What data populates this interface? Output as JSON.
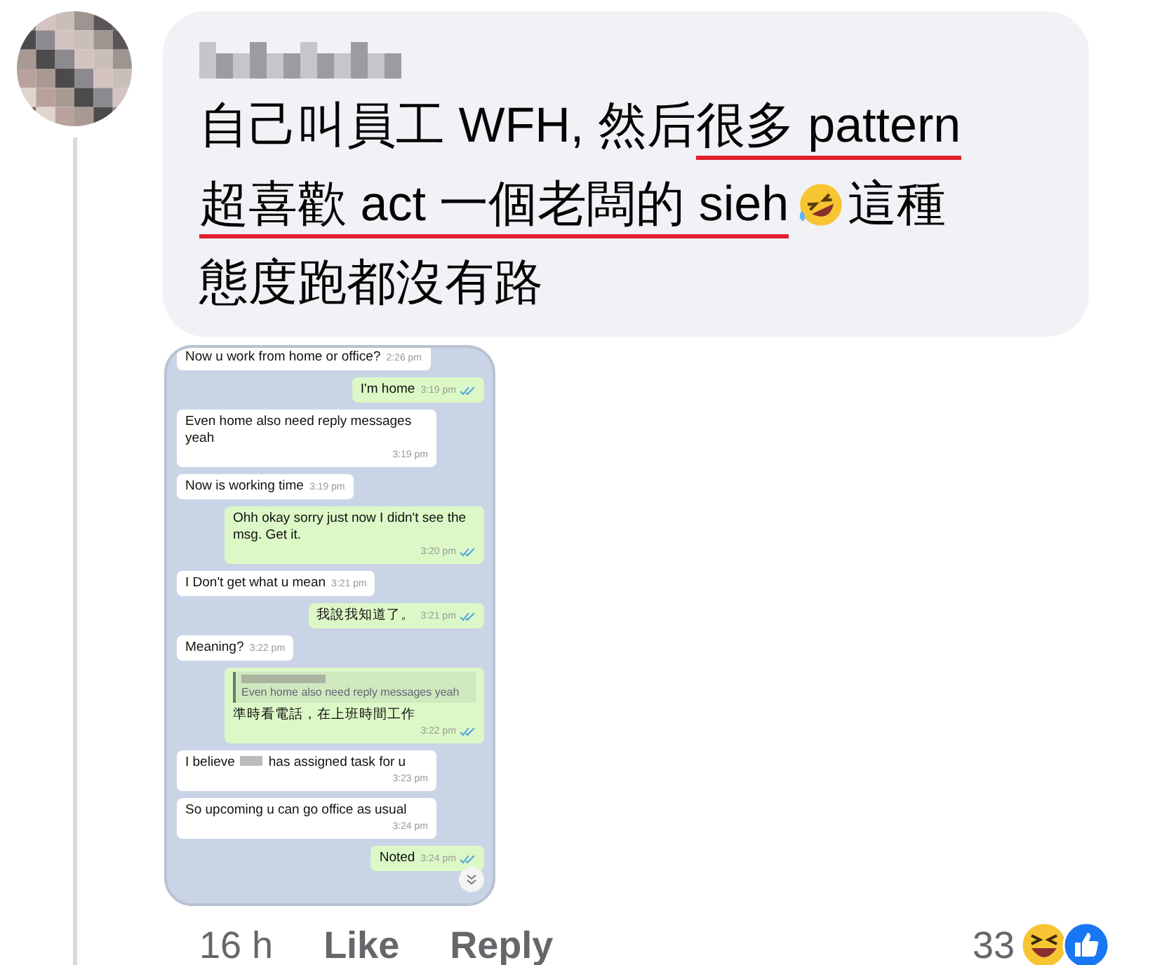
{
  "comment": {
    "lines": [
      [
        {
          "kind": "text",
          "text": "自己叫員工 WFH, 然后",
          "underlined": false
        },
        {
          "kind": "text",
          "text": "很多 pattern",
          "underlined": true
        }
      ],
      [
        {
          "kind": "text",
          "text": "超喜歡 act 一個老闆的 sieh",
          "underlined": true
        },
        {
          "kind": "emoji"
        },
        {
          "kind": "text",
          "text": "這種",
          "underlined": false
        }
      ],
      [
        {
          "kind": "text",
          "text": "態度跑都沒有路",
          "underlined": false
        }
      ]
    ],
    "attachment": {
      "messages": [
        {
          "kind": "incoming",
          "text": "Now u work from home or office?",
          "time": "2:26 pm"
        },
        {
          "kind": "outgoing",
          "text": "I'm home",
          "time": "3:19 pm",
          "read": true
        },
        {
          "kind": "incoming",
          "text": "Even home also need reply messages yeah",
          "time": "3:19 pm"
        },
        {
          "kind": "incoming",
          "text": "Now is working time",
          "time": "3:19 pm"
        },
        {
          "kind": "outgoing",
          "text": "Ohh okay sorry just now I didn't see the msg. Get it.",
          "time": "3:20 pm",
          "read": true
        },
        {
          "kind": "incoming",
          "text": "I Don't get what u mean",
          "time": "3:21 pm"
        },
        {
          "kind": "outgoing",
          "text": "我說我知道了。",
          "time": "3:21 pm",
          "read": true
        },
        {
          "kind": "incoming",
          "text": "Meaning?",
          "time": "3:22 pm"
        },
        {
          "kind": "outgoing",
          "quote": "Even home also need reply messages yeah",
          "text": "準時看電話，在上班時間工作",
          "time": "3:22 pm",
          "read": true
        },
        {
          "kind": "incoming",
          "text": "I believe",
          "text_after": "has assigned task for u",
          "time": "3:23 pm"
        },
        {
          "kind": "incoming",
          "text": "So upcoming u can go office as usual",
          "time": "3:24 pm"
        },
        {
          "kind": "outgoing",
          "text": "Noted",
          "time": "3:24 pm",
          "read": true
        }
      ]
    },
    "time": "16 h",
    "actions": [
      "Like",
      "Reply"
    ],
    "reaction_count": "33"
  }
}
